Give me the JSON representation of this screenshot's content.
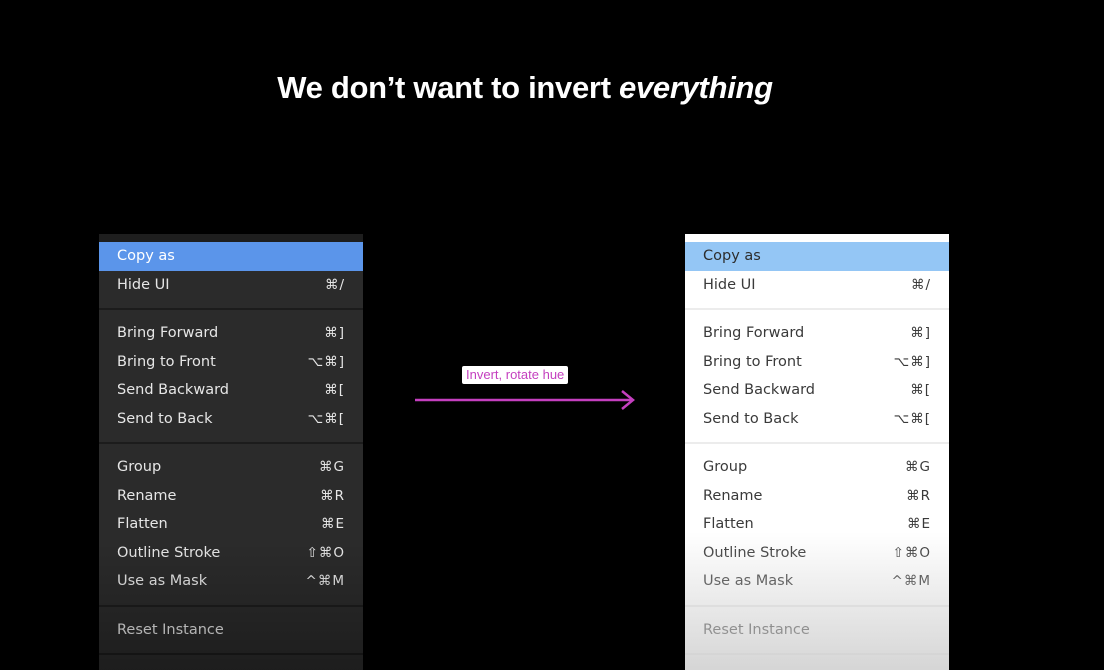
{
  "slide": {
    "title_main": "We don’t want to invert ",
    "title_emph": "everything"
  },
  "annotation": {
    "label": "Invert, rotate hue",
    "arrow_color": "#c43fbf"
  },
  "colors": {
    "background": "#000000",
    "dark_menu_bg": "#2b2b2b",
    "dark_highlight": "#5b95ea",
    "light_menu_bg": "#ffffff",
    "light_highlight": "#94c6f5"
  },
  "dark_menu": {
    "items": [
      {
        "label": "Copy as",
        "shortcut": ""
      },
      {
        "label": "Hide UI",
        "shortcut": "⌘/"
      },
      {
        "label": "Bring Forward",
        "shortcut": "⌘]"
      },
      {
        "label": "Bring to Front",
        "shortcut": "⌥⌘]"
      },
      {
        "label": "Send Backward",
        "shortcut": "⌘["
      },
      {
        "label": "Send to Back",
        "shortcut": "⌥⌘["
      },
      {
        "label": "Group",
        "shortcut": "⌘G"
      },
      {
        "label": "Rename",
        "shortcut": "⌘R"
      },
      {
        "label": "Flatten",
        "shortcut": "⌘E"
      },
      {
        "label": "Outline Stroke",
        "shortcut": "⇧⌘O"
      },
      {
        "label": "Use as Mask",
        "shortcut": "^⌘M"
      },
      {
        "label": "Reset Instance",
        "shortcut": ""
      }
    ]
  },
  "light_menu": {
    "items": [
      {
        "label": "Copy as",
        "shortcut": ""
      },
      {
        "label": "Hide UI",
        "shortcut": "⌘/"
      },
      {
        "label": "Bring Forward",
        "shortcut": "⌘]"
      },
      {
        "label": "Bring to Front",
        "shortcut": "⌥⌘]"
      },
      {
        "label": "Send Backward",
        "shortcut": "⌘["
      },
      {
        "label": "Send to Back",
        "shortcut": "⌥⌘["
      },
      {
        "label": "Group",
        "shortcut": "⌘G"
      },
      {
        "label": "Rename",
        "shortcut": "⌘R"
      },
      {
        "label": "Flatten",
        "shortcut": "⌘E"
      },
      {
        "label": "Outline Stroke",
        "shortcut": "⇧⌘O"
      },
      {
        "label": "Use as Mask",
        "shortcut": "^⌘M"
      },
      {
        "label": "Reset Instance",
        "shortcut": ""
      }
    ]
  }
}
